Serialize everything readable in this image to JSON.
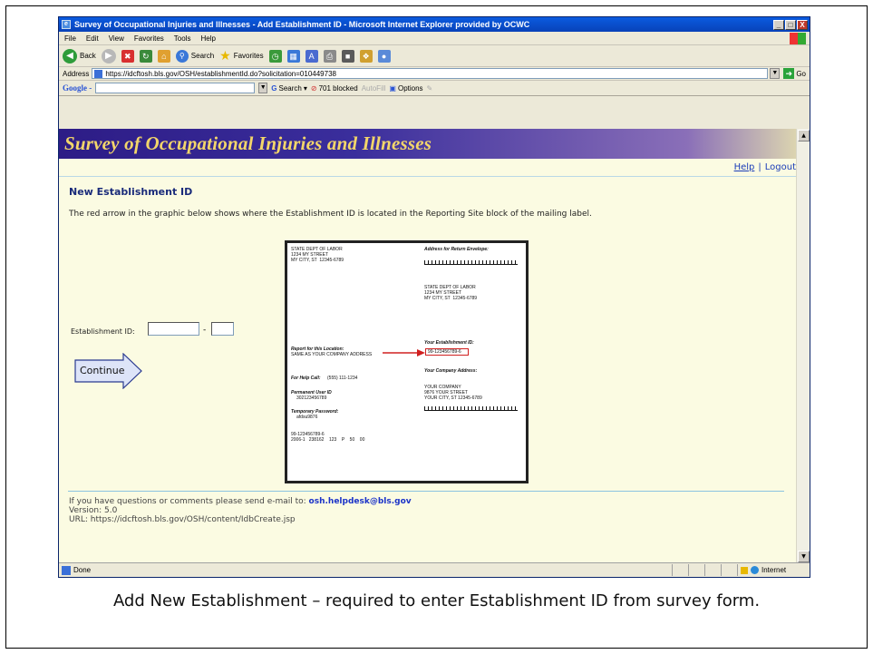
{
  "window": {
    "title": "Survey of Occupational Injuries and Illnesses - Add Establishment ID - Microsoft Internet Explorer provided by OCWC",
    "minimize": "_",
    "maximize": "□",
    "close": "X"
  },
  "menu": [
    "File",
    "Edit",
    "View",
    "Favorites",
    "Tools",
    "Help"
  ],
  "toolbar": {
    "back": "Back",
    "search": "Search",
    "favorites": "Favorites"
  },
  "address": {
    "label": "Address",
    "url": "https://idcftosh.bls.gov/OSH/establishmentId.do?solicitation=010449738",
    "go": "Go"
  },
  "googlebar": {
    "logo": "Google -",
    "search": "Search",
    "blocked": "701 blocked",
    "autofill": "AutoFill",
    "options": "Options"
  },
  "page": {
    "banner": "Survey of Occupational Injuries and Illnesses",
    "help_link": "Help",
    "sep": "|",
    "logout_link": "Logout",
    "heading": "New Establishment ID",
    "intro": "The red arrow in the graphic below shows where the Establishment ID is located in the Reporting Site block of the mailing label.",
    "est_label": "Establishment ID:",
    "dash": "-",
    "continue": "Continue",
    "est_value_a": "",
    "est_value_b": ""
  },
  "label_card": {
    "sender": "STATE DEPT OF LABOR\n1234 MY STREET\nMY CITY, ST  12345-6789",
    "return_title": "Address for Return Envelope:",
    "return_addr": "STATE DEPT OF LABOR\n1234 MY STREET\nMY CITY, ST  12345-6789",
    "est_title": "Your Establishment ID:",
    "est_id": "99-123456789-6",
    "report_title": "Report for this Location:",
    "report_value": "SAME AS YOUR COMPANY ADDRESS",
    "company_title": "Your Company Address:",
    "company_addr": "YOUR COMPANY\n9876 YOUR STREET\nYOUR CITY, ST 12345-6789",
    "help_call": "For Help Call:",
    "help_phone": "(555) 111-1234",
    "perm_title": "Permanent User ID",
    "perm_value": "302123456789",
    "temp_title": "Temporary Password:",
    "temp_value": "afdsu9876",
    "code_line1": "99-123456789-6",
    "code_line2": "2006-1   238162    123    P    50    00"
  },
  "footer": {
    "question": "If you have questions or comments please send e-mail to: ",
    "email": "osh.helpdesk@bls.gov",
    "version": "Version: 5.0",
    "url": "URL: https://idcftosh.bls.gov/OSH/content/IdbCreate.jsp"
  },
  "status": {
    "done": "Done",
    "zone": "Internet"
  },
  "caption": "Add New Establishment – required to enter Establishment ID from survey form."
}
